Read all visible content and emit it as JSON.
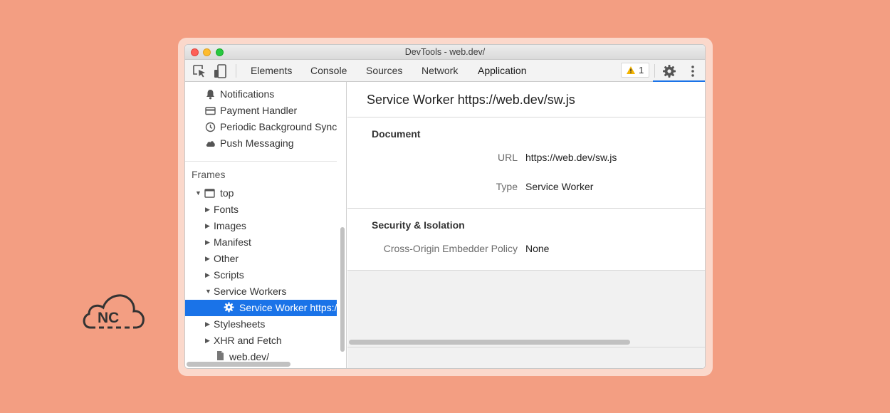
{
  "window": {
    "title": "DevTools - web.dev/"
  },
  "toolbar": {
    "tabs": [
      "Elements",
      "Console",
      "Sources",
      "Network",
      "Application"
    ],
    "active_tab": "Application",
    "more_tabs_glyph": "»",
    "warnings_count": "1",
    "icons": [
      "inspect-element-icon",
      "device-toolbar-icon",
      "more-tabs-icon",
      "warning-icon",
      "gear-icon",
      "kebab-menu-icon"
    ]
  },
  "sidebar": {
    "bg_services": [
      {
        "label": "Notifications",
        "icon": "bell-icon"
      },
      {
        "label": "Payment Handler",
        "icon": "credit-card-icon"
      },
      {
        "label": "Periodic Background Sync",
        "icon": "clock-icon"
      },
      {
        "label": "Push Messaging",
        "icon": "cloud-icon"
      }
    ],
    "frames_header": "Frames",
    "top_frame": "top",
    "children": [
      "Fonts",
      "Images",
      "Manifest",
      "Other",
      "Scripts",
      "Service Workers"
    ],
    "service_worker_item": "Service Worker https://",
    "children_after": [
      "Stylesheets",
      "XHR and Fetch"
    ],
    "document_item": "web.dev/"
  },
  "main": {
    "title": "Service Worker https://web.dev/sw.js",
    "document_section": "Document",
    "url_label": "URL",
    "url_value": "https://web.dev/sw.js",
    "type_label": "Type",
    "type_value": "Service Worker",
    "security_section": "Security & Isolation",
    "coep_label": "Cross-Origin Embedder Policy",
    "coep_value": "None"
  },
  "brand": {
    "logo_text": "NC"
  },
  "colors": {
    "background": "#f39e82",
    "accent": "#1a73e8",
    "selection_text": "#ffffff"
  }
}
